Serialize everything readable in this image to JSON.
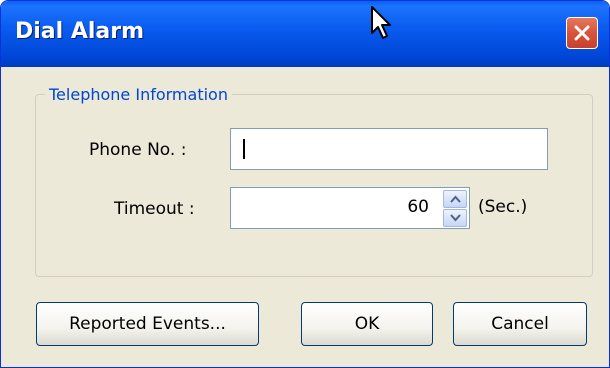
{
  "window": {
    "title": "Dial Alarm"
  },
  "group": {
    "title": "Telephone Information"
  },
  "fields": {
    "phone_label": "Phone No. :",
    "phone_value": "",
    "timeout_label": "Timeout :",
    "timeout_value": "60",
    "timeout_unit": "(Sec.)"
  },
  "buttons": {
    "reported_events": "Reported Events...",
    "ok": "OK",
    "cancel": "Cancel"
  },
  "icons": {
    "close": "close-icon",
    "spin_up": "spin-up-icon",
    "spin_down": "spin-down-icon",
    "pointer": "mouse-pointer-icon"
  },
  "colors": {
    "titlebar": "#0a5cf0",
    "close": "#d9533a",
    "group_title": "#0046d5",
    "dialog_bg": "#ece9d8"
  }
}
